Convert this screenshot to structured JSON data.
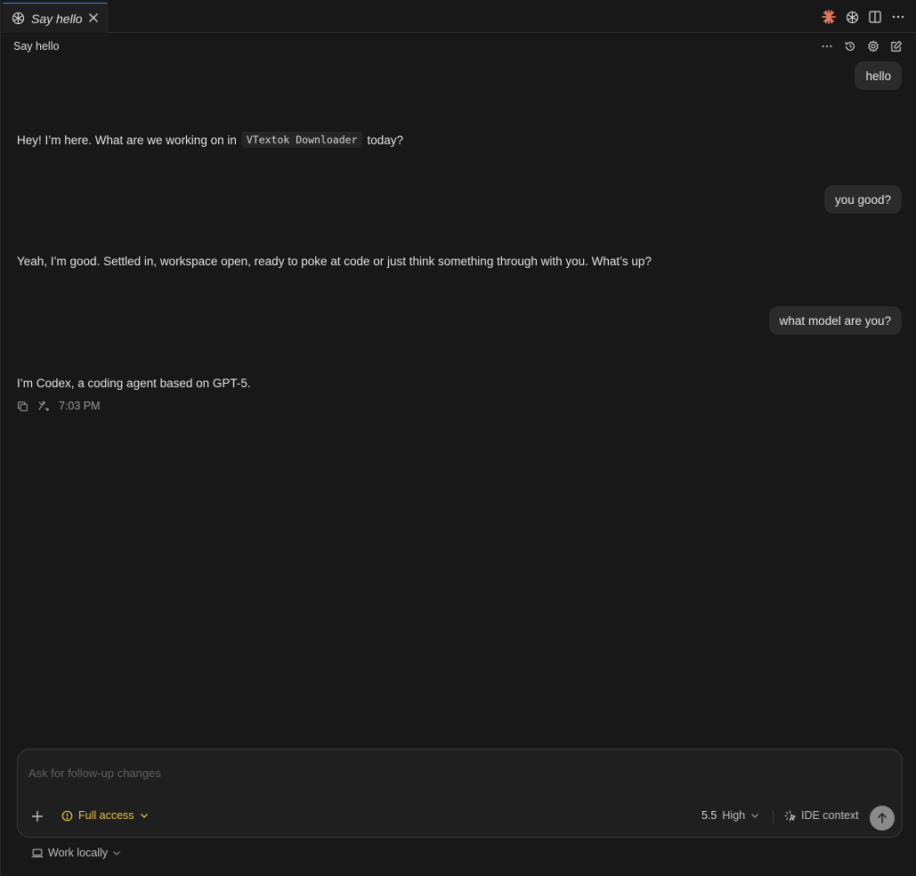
{
  "tab": {
    "title": "Say hello"
  },
  "header": {
    "title": "Say hello"
  },
  "messages": {
    "user1": "hello",
    "assistant1": {
      "before": "Hey! I’m here. What are we working on in",
      "code": "VTextok Downloader",
      "after": "today?"
    },
    "user2": "you good?",
    "assistant2": "Yeah, I’m good. Settled in, workspace open, ready to poke at code or just think something through with you. What’s up?",
    "user3": "what model are you?",
    "assistant3": "I’m Codex, a coding agent based on GPT-5.",
    "timestamp": "7:03 PM"
  },
  "composer": {
    "placeholder": "Ask for follow-up changes",
    "access_label": "Full access",
    "model_version": "5.5",
    "model_effort": "High",
    "ide_context_label": "IDE context"
  },
  "footer": {
    "work_label": "Work locally"
  },
  "colors": {
    "accent_warning": "#e8c140",
    "claude_icon": "#e07a5f",
    "tab_border": "#3a8bd8"
  }
}
